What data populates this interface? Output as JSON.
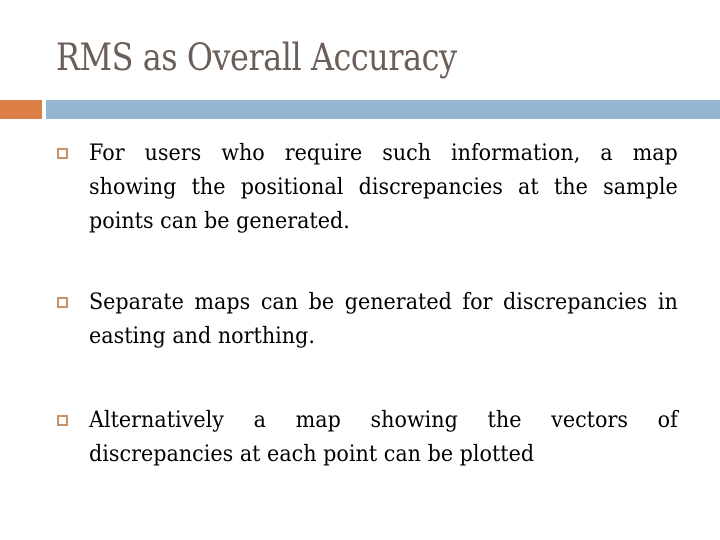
{
  "slide": {
    "title": "RMS as Overall Accuracy",
    "colors": {
      "title": "#6b5e57",
      "accent_bar": "#dd8047",
      "rule_bar": "#94b6d2",
      "bullet_icon": "#c99268",
      "body_text": "#000000"
    },
    "bullet_icon": "hollow-square-icon",
    "bullets": [
      {
        "text": "For users who require such information, a map showing the positional discrepancies at the sample points can be generated."
      },
      {
        "text": "Separate maps can be generated for discrepancies in easting and northing."
      },
      {
        "text": "Alternatively a map showing the vectors of discrepancies at each point can be plotted"
      }
    ]
  }
}
